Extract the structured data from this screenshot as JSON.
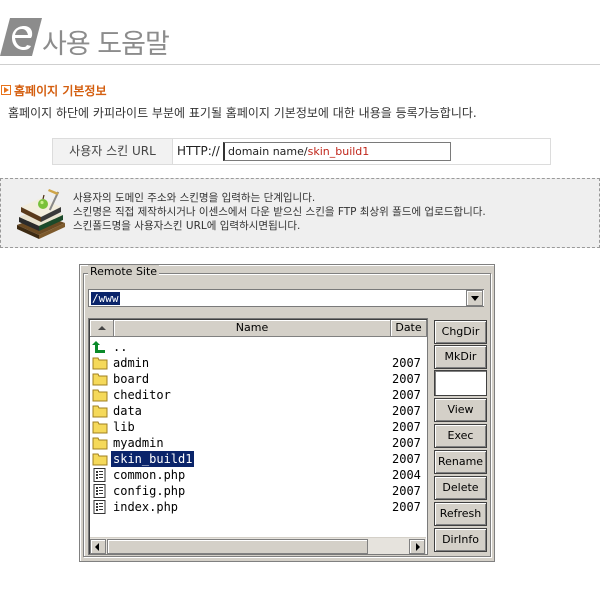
{
  "header": {
    "title": "사용 도움말",
    "logo_icon": "e-logo-icon"
  },
  "section": {
    "title": "홈페이지 기본정보",
    "description": "홈페이지 하단에 카피라이트 부분에 표기될 홈페이지 기본정보에 대한 내용을 등록가능합니다."
  },
  "skin_url": {
    "label": "사용자 스킨 URL",
    "prefix": "HTTP://",
    "value_domain": "domain name/",
    "value_skin": "skin_build1"
  },
  "info": {
    "lines": [
      "사용자의 도메인 주소와 스킨명을 입력하는 단계입니다.",
      "스킨명은 직접 제작하시거나 이센스에서 다운 받으신 스킨을 FTP 최상위 폴드에 업로드합니다.",
      "스킨폴드명을 사용자스킨 URL에 입력하시면됩니다."
    ]
  },
  "ftp": {
    "legend": "Remote Site",
    "path": "/www",
    "columns": {
      "name": "Name",
      "date": "Date"
    },
    "files": [
      {
        "name": "..",
        "date": "",
        "icon": "up-arrow-icon",
        "selected": false
      },
      {
        "name": "admin",
        "date": "2007",
        "icon": "folder-icon",
        "selected": false
      },
      {
        "name": "board",
        "date": "2007",
        "icon": "folder-icon",
        "selected": false
      },
      {
        "name": "cheditor",
        "date": "2007",
        "icon": "folder-icon",
        "selected": false
      },
      {
        "name": "data",
        "date": "2007",
        "icon": "folder-icon",
        "selected": false
      },
      {
        "name": "lib",
        "date": "2007",
        "icon": "folder-icon",
        "selected": false
      },
      {
        "name": "myadmin",
        "date": "2007",
        "icon": "folder-icon",
        "selected": false
      },
      {
        "name": "skin_build1",
        "date": "2007",
        "icon": "folder-icon",
        "selected": true
      },
      {
        "name": "common.php",
        "date": "2004",
        "icon": "file-icon",
        "selected": false
      },
      {
        "name": "config.php",
        "date": "2007",
        "icon": "file-icon",
        "selected": false
      },
      {
        "name": "index.php",
        "date": "2007",
        "icon": "file-icon",
        "selected": false
      }
    ],
    "buttons": {
      "chgdir": "ChgDir",
      "mkdir": "MkDir",
      "view": "View",
      "exec": "Exec",
      "rename": "Rename",
      "delete": "Delete",
      "refresh": "Refresh",
      "dirinfo": "DirInfo"
    }
  },
  "colors": {
    "accent": "#d45f10",
    "selection": "#0a246a",
    "window_face": "#d4d0c8",
    "skin_name": "#c0251a"
  }
}
